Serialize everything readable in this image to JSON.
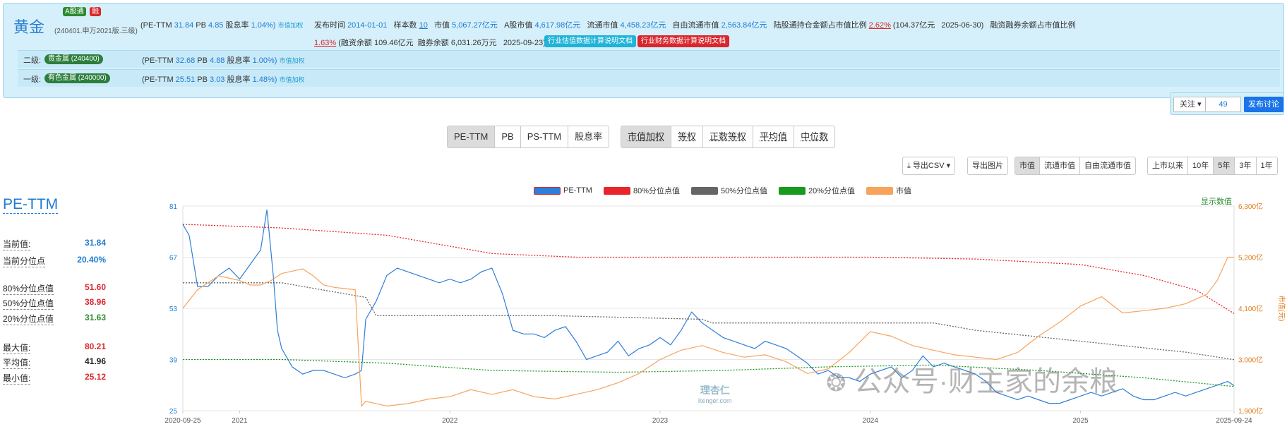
{
  "header": {
    "name": "黄金",
    "badge_a": "A股通",
    "badge_b": "融",
    "code": "(240401.申万2021版.三级)",
    "pe_label": "(PE-TTM",
    "pe_val": "31.84",
    "pb_label": "PB",
    "pb_val": "4.85",
    "div_label": "股息率",
    "div_val": "1.04%)",
    "weight_link": "市值加权",
    "pub_label": "发布时间",
    "pub_val": "2014-01-01",
    "sample_label": "样本数",
    "sample_val": "10",
    "mcap_label": "市值",
    "mcap_val": "5,067.27亿元",
    "amcap_label": "A股市值",
    "amcap_val": "4,617.98亿元",
    "float_label": "流通市值",
    "float_val": "4,458.23亿元",
    "ffloat_label": "自由流通市值",
    "ffloat_val": "2,563.84亿元",
    "hk_label": "陆股通持仓金额占市值比例",
    "hk_pct": "2.62%",
    "hk_amt": "(104.37亿元",
    "hk_date": "2025-06-30)",
    "margin_label": "融资融券余额占市值比例",
    "margin_pct": "1.63%",
    "fin_bal": "(融资余额 109.46亿元",
    "sec_bal": "融券余额 6,031.26万元",
    "margin_date": "2025-09-23)",
    "doc_btn1": "行业估值数据计算说明文档",
    "doc_btn2": "行业财务数据计算说明文档"
  },
  "levels": [
    {
      "label": "二级:",
      "pill": "贵金属 (240400)",
      "pe_label": "(PE-TTM",
      "pe": "32.68",
      "pb_label": "PB",
      "pb": "4.88",
      "div_label": "股息率",
      "div": "1.00%)",
      "link": "市值加权"
    },
    {
      "label": "一级:",
      "pill": "有色金属 (240000)",
      "pe_label": "(PE-TTM",
      "pe": "25.51",
      "pb_label": "PB",
      "pb": "3.03",
      "div_label": "股息率",
      "div": "1.48%)",
      "link": "市值加权"
    }
  ],
  "follow": {
    "label": "关注",
    "count": "49",
    "discuss": "发布讨论"
  },
  "metric_tabs": [
    "PE-TTM",
    "PB",
    "PS-TTM",
    "股息率"
  ],
  "weight_tabs": [
    "市值加权",
    "等权",
    "正数等权",
    "平均值",
    "中位数"
  ],
  "export_csv": "导出CSV",
  "export_img": "导出图片",
  "cap_tabs": [
    "市值",
    "流通市值",
    "自由流通市值"
  ],
  "range_tabs": [
    "上市以来",
    "10年",
    "5年",
    "3年",
    "1年"
  ],
  "legend": [
    {
      "name": "PE-TTM",
      "color": "#2f7ed8"
    },
    {
      "name": "80%分位点值",
      "color": "#e8262a"
    },
    {
      "name": "50%分位点值",
      "color": "#666666"
    },
    {
      "name": "20%分位点值",
      "color": "#199a1e"
    },
    {
      "name": "市值",
      "color": "#f7a35c"
    }
  ],
  "stats": {
    "title": "PE-TTM",
    "rows": [
      {
        "label": "当前值:",
        "value": "31.84",
        "color": "#1f7ad3"
      },
      {
        "label": "当前分位点",
        "value": "20.40%",
        "color": "#1f7ad3"
      },
      {
        "label": "80%分位点值",
        "value": "51.60",
        "color": "#d9272e"
      },
      {
        "label": "50%分位点值",
        "value": "38.96",
        "color": "#d9272e"
      },
      {
        "label": "20%分位点值",
        "value": "31.63",
        "color": "#2c8a2f"
      },
      {
        "label": "最大值:",
        "value": "80.21",
        "color": "#d9272e"
      },
      {
        "label": "平均值:",
        "value": "41.96",
        "color": "#222222"
      },
      {
        "label": "最小值:",
        "value": "25.12",
        "color": "#d9272e"
      }
    ]
  },
  "show_values_link": "显示数值",
  "watermark": "公众号·财主家的余粮",
  "watermark_small": "理杏仁",
  "watermark_small_url": "lixinger.com",
  "chart_data": {
    "type": "line",
    "title": "",
    "y_left_ticks": [
      "81",
      "67",
      "53",
      "39",
      "25"
    ],
    "y_right_ticks": [
      "6,300亿",
      "5,200亿",
      "4,100亿",
      "3,000亿",
      "1,900亿"
    ],
    "y_right_label": "市值(元)",
    "x_ticks": [
      "2020-09-25",
      "2021",
      "2022",
      "2023",
      "2024",
      "2025",
      "2025-09-24"
    ],
    "ylim_left": [
      25,
      81
    ],
    "ylim_right": [
      1900,
      6300
    ],
    "legend_position": "top-center",
    "series": [
      {
        "name": "PE-TTM",
        "axis": "left",
        "color": "#2f7ed8",
        "x": [
          2020.73,
          2020.76,
          2020.8,
          2020.85,
          2020.9,
          2020.95,
          2021.0,
          2021.05,
          2021.1,
          2021.13,
          2021.16,
          2021.18,
          2021.2,
          2021.25,
          2021.3,
          2021.35,
          2021.4,
          2021.45,
          2021.5,
          2021.55,
          2021.58,
          2021.6,
          2021.65,
          2021.7,
          2021.75,
          2021.8,
          2021.85,
          2021.9,
          2021.95,
          2022.0,
          2022.05,
          2022.1,
          2022.15,
          2022.2,
          2022.25,
          2022.3,
          2022.35,
          2022.4,
          2022.45,
          2022.5,
          2022.55,
          2022.6,
          2022.65,
          2022.7,
          2022.75,
          2022.8,
          2022.85,
          2022.9,
          2022.95,
          2023.0,
          2023.05,
          2023.1,
          2023.15,
          2023.2,
          2023.25,
          2023.3,
          2023.35,
          2023.4,
          2023.45,
          2023.5,
          2023.55,
          2023.6,
          2023.65,
          2023.7,
          2023.75,
          2023.8,
          2023.85,
          2023.9,
          2023.95,
          2024.0,
          2024.05,
          2024.1,
          2024.15,
          2024.2,
          2024.25,
          2024.3,
          2024.35,
          2024.4,
          2024.45,
          2024.5,
          2024.55,
          2024.6,
          2024.65,
          2024.7,
          2024.75,
          2024.8,
          2024.85,
          2024.9,
          2024.95,
          2025.0,
          2025.05,
          2025.1,
          2025.15,
          2025.2,
          2025.25,
          2025.3,
          2025.35,
          2025.4,
          2025.45,
          2025.5,
          2025.55,
          2025.6,
          2025.65,
          2025.7,
          2025.73
        ],
        "y": [
          76,
          73,
          59,
          59,
          62,
          64,
          61,
          65,
          69,
          80,
          62,
          47,
          42,
          37,
          35,
          36,
          36,
          35,
          34,
          35,
          36,
          50,
          55,
          62,
          64,
          63,
          62,
          61,
          60,
          61,
          60,
          61,
          63,
          64,
          57,
          47,
          46,
          46,
          45,
          47,
          48,
          44,
          39,
          40,
          41,
          44,
          40,
          42,
          43,
          45,
          43,
          47,
          52,
          49,
          47,
          45,
          44,
          43,
          42,
          44,
          43,
          42,
          40,
          38,
          35,
          36,
          34,
          34,
          33,
          35,
          36,
          37,
          34,
          36,
          40,
          37,
          38,
          37,
          36,
          35,
          33,
          30,
          29,
          28,
          29,
          28,
          27,
          27,
          28,
          29,
          30,
          29,
          30,
          31,
          29,
          28,
          28,
          29,
          30,
          29,
          30,
          31,
          32,
          33,
          31.84
        ]
      },
      {
        "name": "80%分位点值",
        "axis": "left",
        "color": "#e8262a",
        "x": [
          2020.73,
          2021.2,
          2021.7,
          2022.2,
          2022.6,
          2023.0,
          2023.5,
          2024.0,
          2024.5,
          2025.0,
          2025.3,
          2025.55,
          2025.73
        ],
        "y": [
          76,
          75,
          73,
          68,
          67,
          67,
          67,
          67,
          66.5,
          65,
          62,
          58,
          51.6
        ]
      },
      {
        "name": "50%分位点值",
        "axis": "left",
        "color": "#666666",
        "x": [
          2020.73,
          2021.2,
          2021.6,
          2021.65,
          2022.5,
          2023.2,
          2023.25,
          2024.3,
          2024.5,
          2025.0,
          2025.5,
          2025.73
        ],
        "y": [
          60,
          60,
          56,
          51,
          51,
          50,
          49,
          49,
          47,
          44,
          41,
          38.96
        ]
      },
      {
        "name": "20%分位点值",
        "axis": "left",
        "color": "#199a1e",
        "x": [
          2020.73,
          2021.2,
          2021.7,
          2022.2,
          2022.8,
          2023.3,
          2023.8,
          2024.3,
          2024.8,
          2025.3,
          2025.73
        ],
        "y": [
          39,
          39,
          38,
          36,
          35.5,
          36,
          37,
          37.5,
          36,
          34,
          31.63
        ]
      },
      {
        "name": "市值",
        "axis": "right",
        "color": "#f7a35c",
        "x": [
          2020.73,
          2020.8,
          2020.9,
          2021.0,
          2021.05,
          2021.1,
          2021.15,
          2021.2,
          2021.25,
          2021.3,
          2021.35,
          2021.4,
          2021.45,
          2021.55,
          2021.58,
          2021.6,
          2021.7,
          2021.8,
          2021.9,
          2022.0,
          2022.1,
          2022.2,
          2022.3,
          2022.4,
          2022.5,
          2022.6,
          2022.7,
          2022.8,
          2022.9,
          2023.0,
          2023.1,
          2023.2,
          2023.3,
          2023.4,
          2023.5,
          2023.6,
          2023.7,
          2023.8,
          2023.9,
          2024.0,
          2024.1,
          2024.2,
          2024.3,
          2024.4,
          2024.5,
          2024.6,
          2024.7,
          2024.8,
          2024.9,
          2025.0,
          2025.1,
          2025.2,
          2025.3,
          2025.4,
          2025.5,
          2025.6,
          2025.65,
          2025.7,
          2025.73
        ],
        "y": [
          4100,
          4500,
          4800,
          4700,
          4600,
          4600,
          4700,
          4850,
          4900,
          4950,
          4800,
          4600,
          4550,
          4500,
          2000,
          2100,
          2000,
          2050,
          2150,
          2200,
          2350,
          2250,
          2350,
          2200,
          2150,
          2250,
          2350,
          2500,
          2700,
          3000,
          3200,
          3300,
          3150,
          3050,
          3100,
          2950,
          2700,
          2800,
          3150,
          3600,
          3500,
          3300,
          3200,
          3100,
          3050,
          3000,
          3150,
          3500,
          3800,
          4150,
          4350,
          4000,
          4050,
          4100,
          4200,
          4400,
          4700,
          5200,
          5200
        ]
      }
    ]
  }
}
